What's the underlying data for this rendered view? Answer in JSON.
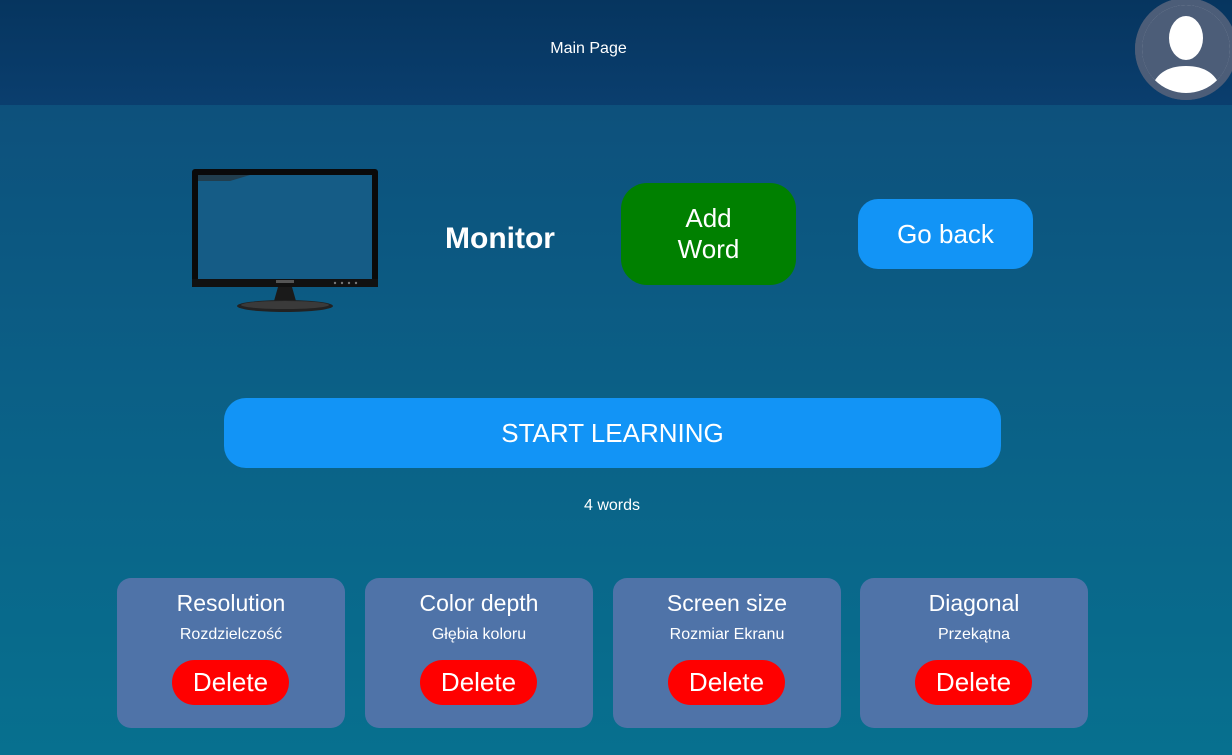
{
  "header": {
    "title": "Main Page"
  },
  "topic": {
    "name": "Monitor",
    "image": "monitor-image"
  },
  "buttons": {
    "add_word": "Add Word",
    "go_back": "Go back",
    "start_learning": "START LEARNING"
  },
  "word_count": "4 words",
  "words": [
    {
      "term": "Resolution",
      "translation": "Rozdzielczość",
      "delete_label": "Delete"
    },
    {
      "term": "Color depth",
      "translation": "Głębia koloru",
      "delete_label": "Delete"
    },
    {
      "term": "Screen size",
      "translation": "Rozmiar Ekranu",
      "delete_label": "Delete"
    },
    {
      "term": "Diagonal",
      "translation": "Przekątna",
      "delete_label": "Delete"
    }
  ],
  "colors": {
    "header_bg": "#06355f",
    "page_bg_top": "#0e4b78",
    "page_bg_bottom": "#07708f",
    "add_button": "#008000",
    "primary_button": "#1294f6",
    "delete_button": "#ff0000",
    "card_bg": "#4f73a8",
    "avatar_bg": "#4c5d78"
  }
}
